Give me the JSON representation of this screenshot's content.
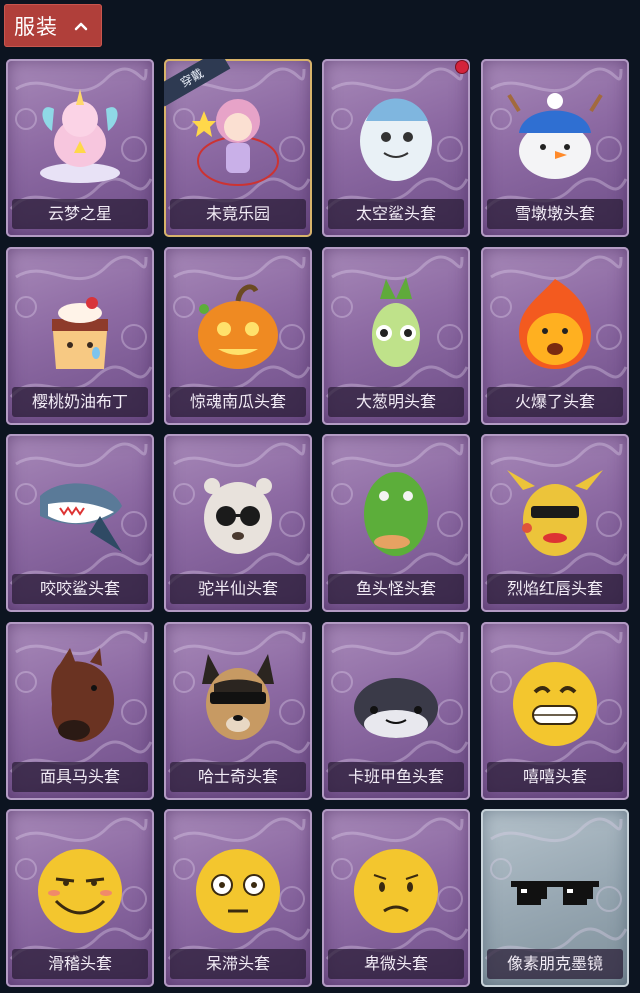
{
  "header": {
    "category_label": "服装"
  },
  "items": [
    {
      "label": "云梦之星",
      "icon": "unicorn-costume-icon"
    },
    {
      "label": "未竟乐园",
      "icon": "wonderland-girl-icon",
      "badge": "穿戴"
    },
    {
      "label": "太空鲨头套",
      "icon": "space-shark-head-icon",
      "new_dot": true
    },
    {
      "label": "雪墩墩头套",
      "icon": "snowman-reindeer-head-icon"
    },
    {
      "label": "樱桃奶油布丁",
      "icon": "cherry-pudding-head-icon"
    },
    {
      "label": "惊魂南瓜头套",
      "icon": "pumpkin-head-icon"
    },
    {
      "label": "大葱明头套",
      "icon": "scallion-head-icon"
    },
    {
      "label": "火爆了头套",
      "icon": "fireball-head-icon"
    },
    {
      "label": "咬咬鲨头套",
      "icon": "shark-head-icon"
    },
    {
      "label": "驼半仙头套",
      "icon": "alpaca-sunglasses-head-icon"
    },
    {
      "label": "鱼头怪头套",
      "icon": "fish-head-icon"
    },
    {
      "label": "烈焰红唇头套",
      "icon": "pikachu-lips-head-icon"
    },
    {
      "label": "面具马头套",
      "icon": "horse-mask-icon"
    },
    {
      "label": "哈士奇头套",
      "icon": "husky-sunglasses-head-icon"
    },
    {
      "label": "卡班甲鱼头套",
      "label_visible": "卡班甲鱼头套",
      "icon": "turtle-head-icon"
    },
    {
      "label": "嘻嘻头套",
      "icon": "grin-emoji-head-icon"
    },
    {
      "label": "滑稽头套",
      "icon": "smirk-emoji-head-icon"
    },
    {
      "label": "呆滞头套",
      "icon": "stunned-emoji-head-icon"
    },
    {
      "label": "卑微头套",
      "icon": "humble-emoji-head-icon"
    },
    {
      "label": "像素朋克墨镜",
      "icon": "pixel-sunglasses-icon"
    }
  ],
  "colors": {
    "background": "#0c1420",
    "category_button": "#b03f3a",
    "card_purple": "#8d6aa3",
    "card_light": "#98a8b3",
    "badge": "#2e3a52",
    "new_dot": "#d4233b"
  }
}
